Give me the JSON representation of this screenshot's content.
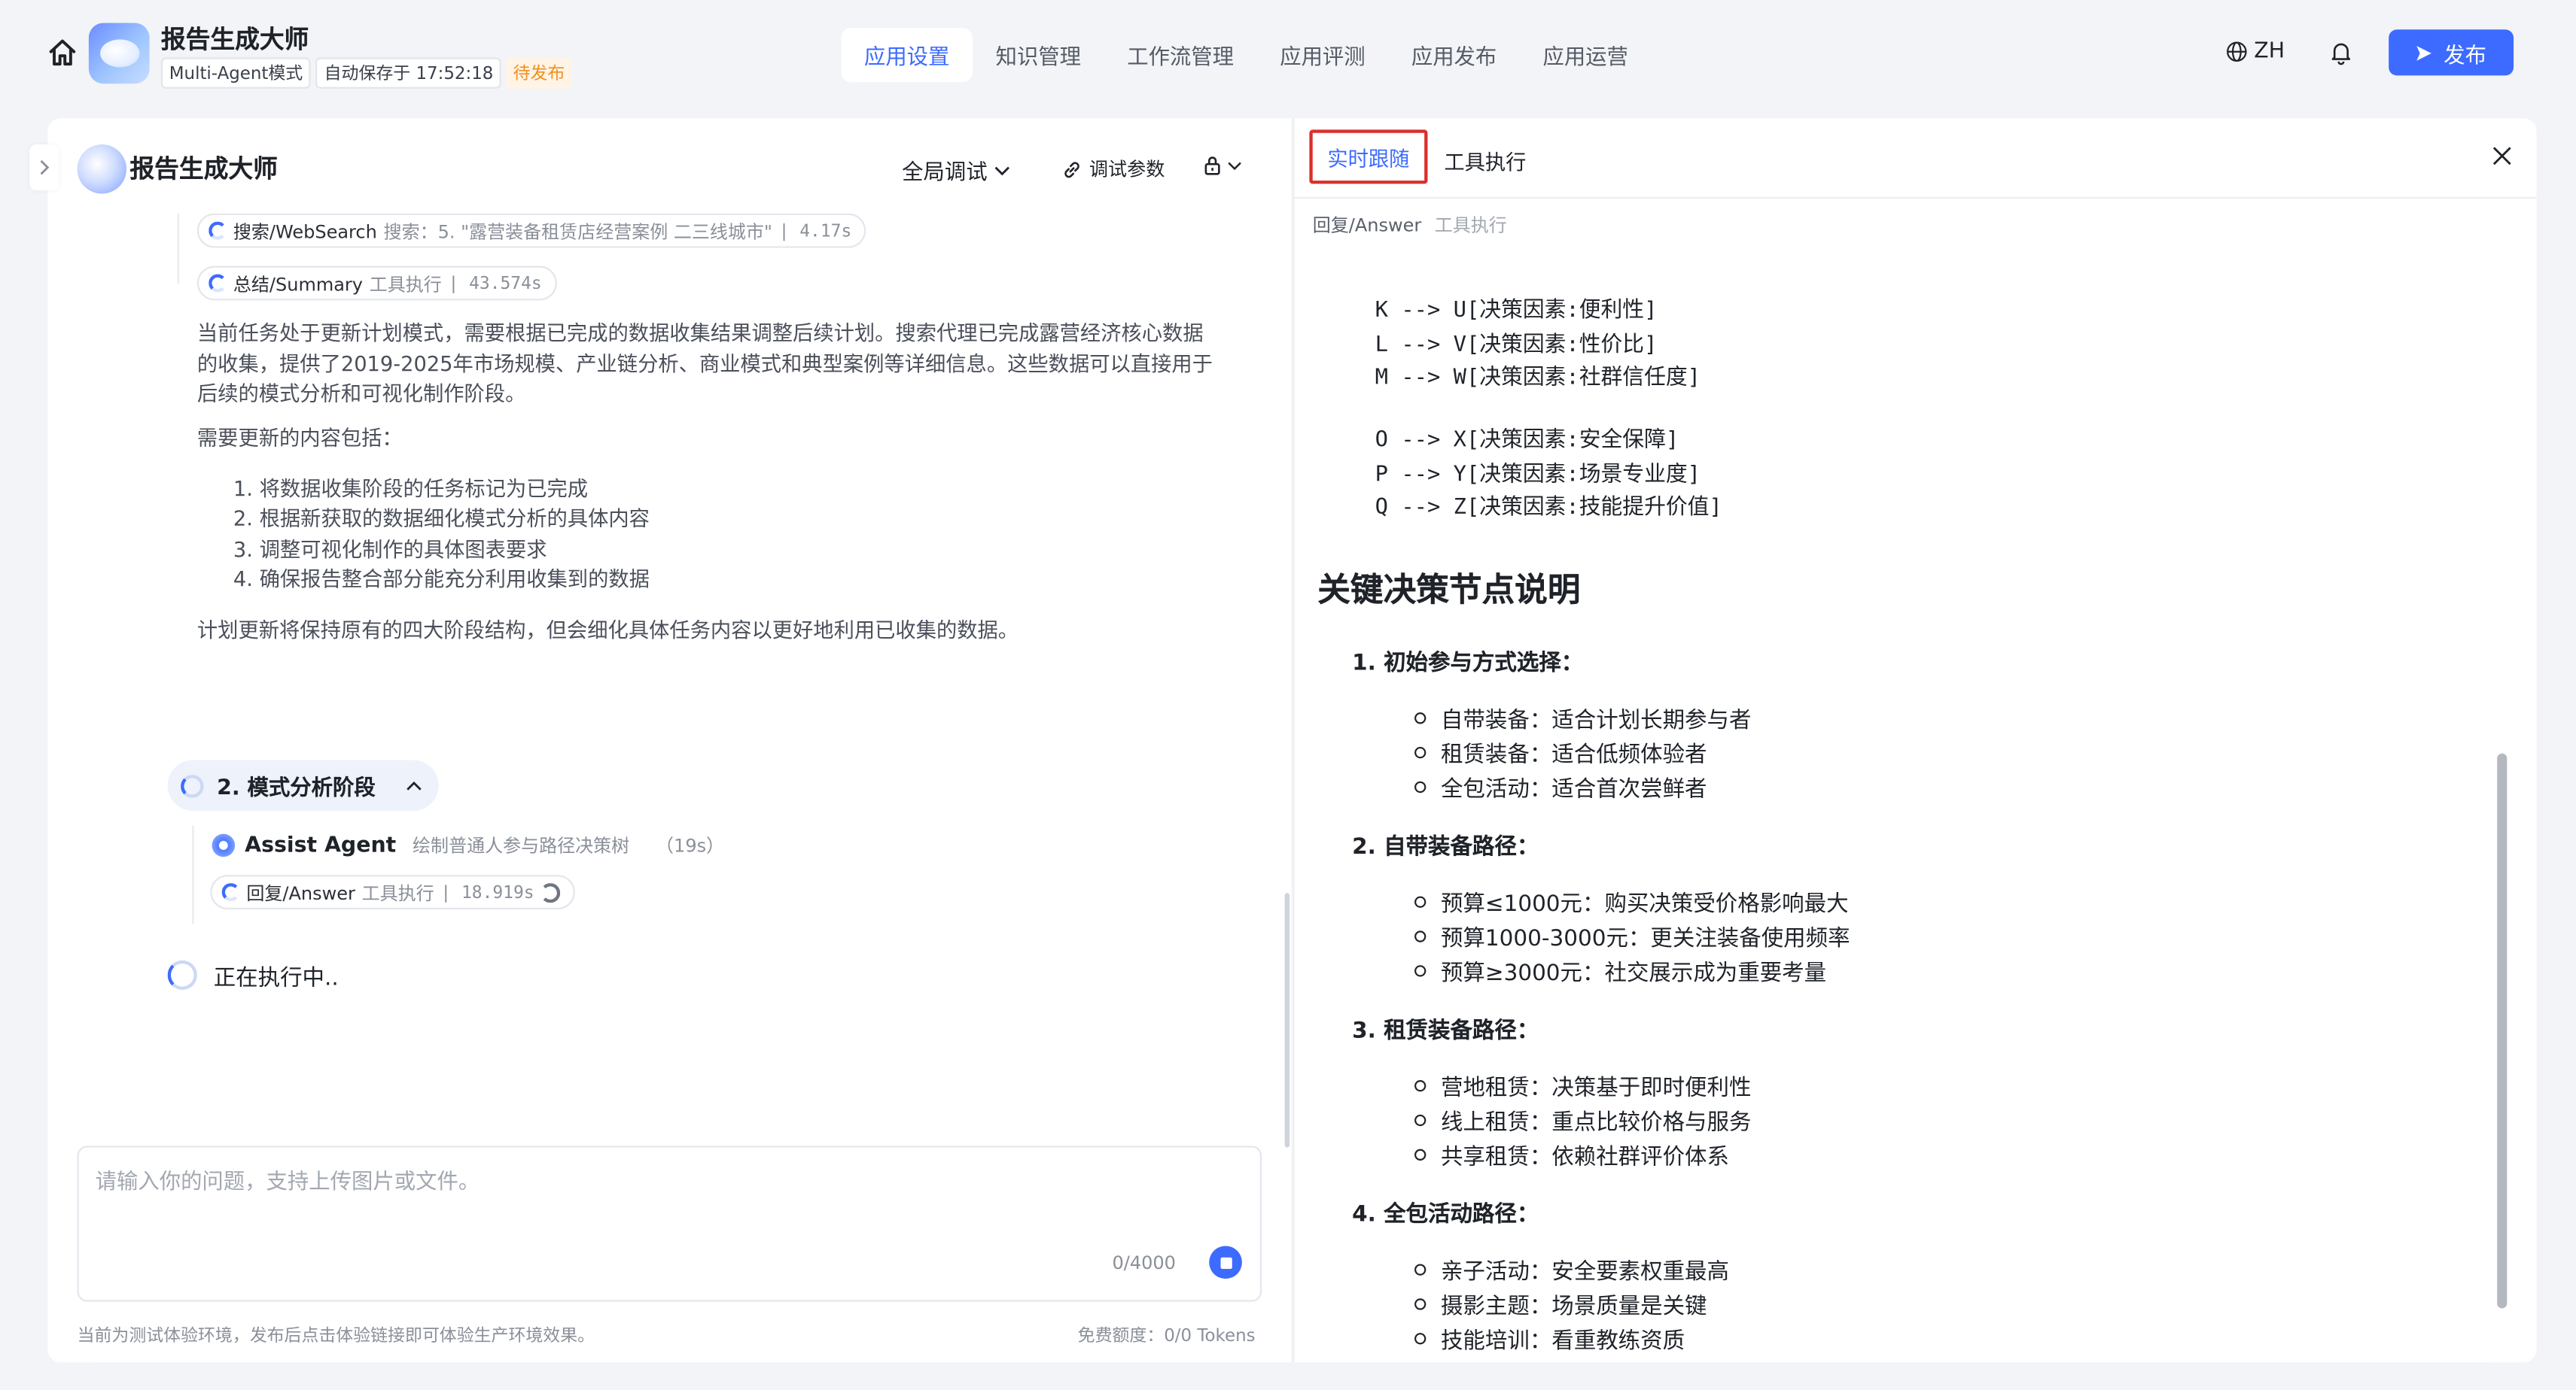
{
  "app": {
    "title": "报告生成大师",
    "mode": "Multi-Agent模式",
    "autosave": "自动保存于 17:52:18",
    "status": "待发布"
  },
  "nav": {
    "items": [
      "应用设置",
      "知识管理",
      "工作流管理",
      "应用评测",
      "应用发布",
      "应用运营"
    ],
    "active_index": 0
  },
  "header_right": {
    "lang": "ZH",
    "publish_label": "发布"
  },
  "chat": {
    "agent_title": "报告生成大师",
    "global_debug": "全局调试",
    "debug_params": "调试参数",
    "tools_top": [
      {
        "name": "搜索/WebSearch",
        "desc": "搜索：5. \"露营装备租赁店经营案例 二三线城市\"",
        "time": "| 4.17s"
      },
      {
        "name": "总结/Summary",
        "desc": "工具执行",
        "time": "| 43.574s"
      }
    ],
    "para1": "当前任务处于更新计划模式，需要根据已完成的数据收集结果调整后续计划。搜索代理已完成露营经济核心数据的收集，提供了2019-2025年市场规模、产业链分析、商业模式和典型案例等详细信息。这些数据可以直接用于后续的模式分析和可视化制作阶段。",
    "para2": "需要更新的内容包括：",
    "list": [
      "1. 将数据收集阶段的任务标记为已完成",
      "2. 根据新获取的数据细化模式分析的具体内容",
      "3. 调整可视化制作的具体图表要求",
      "4. 确保报告整合部分能充分利用收集到的数据"
    ],
    "para3": "计划更新将保持原有的四大阶段结构，但会细化具体任务内容以更好地利用已收集的数据。",
    "stage_title": "2. 模式分析阶段",
    "assist_name": "Assist Agent",
    "assist_desc": "绘制普通人参与路径决策树",
    "assist_time": "（19s）",
    "answer_tool": {
      "name": "回复/Answer",
      "desc": "工具执行",
      "time": "| 18.919s"
    },
    "running": "正在执行中..",
    "input_placeholder": "请输入你的问题，支持上传图片或文件。",
    "counter": "0/4000",
    "footer_note": "当前为测试体验环境，发布后点击体验链接即可体验生产环境效果。",
    "footer_tokens": "免费额度：0/0 Tokens"
  },
  "trace": {
    "tab_live": "实时跟随",
    "tab_tool": "工具执行",
    "crumb": "回复/Answer",
    "crumb_sub": "工具执行",
    "code_block_1": [
      "K --> U[决策因素:便利性]",
      "L --> V[决策因素:性价比]",
      "M --> W[决策因素:社群信任度]"
    ],
    "code_block_2": [
      "O --> X[决策因素:安全保障]",
      "P --> Y[决策因素:场景专业度]",
      "Q --> Z[决策因素:技能提升价值]"
    ],
    "heading": "关键决策节点说明",
    "sections": [
      {
        "title": "1. 初始参与方式选择：",
        "bullets": [
          "自带装备：适合计划长期参与者",
          "租赁装备：适合低频体验者",
          "全包活动：适合首次尝鲜者"
        ]
      },
      {
        "title": "2. 自带装备路径：",
        "bullets": [
          "预算≤1000元：购买决策受价格影响最大",
          "预算1000-3000元：更关注装备使用频率",
          "预算≥3000元：社交展示成为重要考量"
        ]
      },
      {
        "title": "3. 租赁装备路径：",
        "bullets": [
          "营地租赁：决策基于即时便利性",
          "线上租赁：重点比较价格与服务",
          "共享租赁：依赖社群评价体系"
        ]
      },
      {
        "title": "4. 全包活动路径：",
        "bullets": [
          "亲子活动：安全要素权重最高",
          "摄影主题：场景质量是关键",
          "技能培训：看重教练资质"
        ]
      }
    ]
  },
  "colors": {
    "accent": "#3d6bff",
    "pending": "#f0901e",
    "highlight_border": "#d9302b"
  }
}
